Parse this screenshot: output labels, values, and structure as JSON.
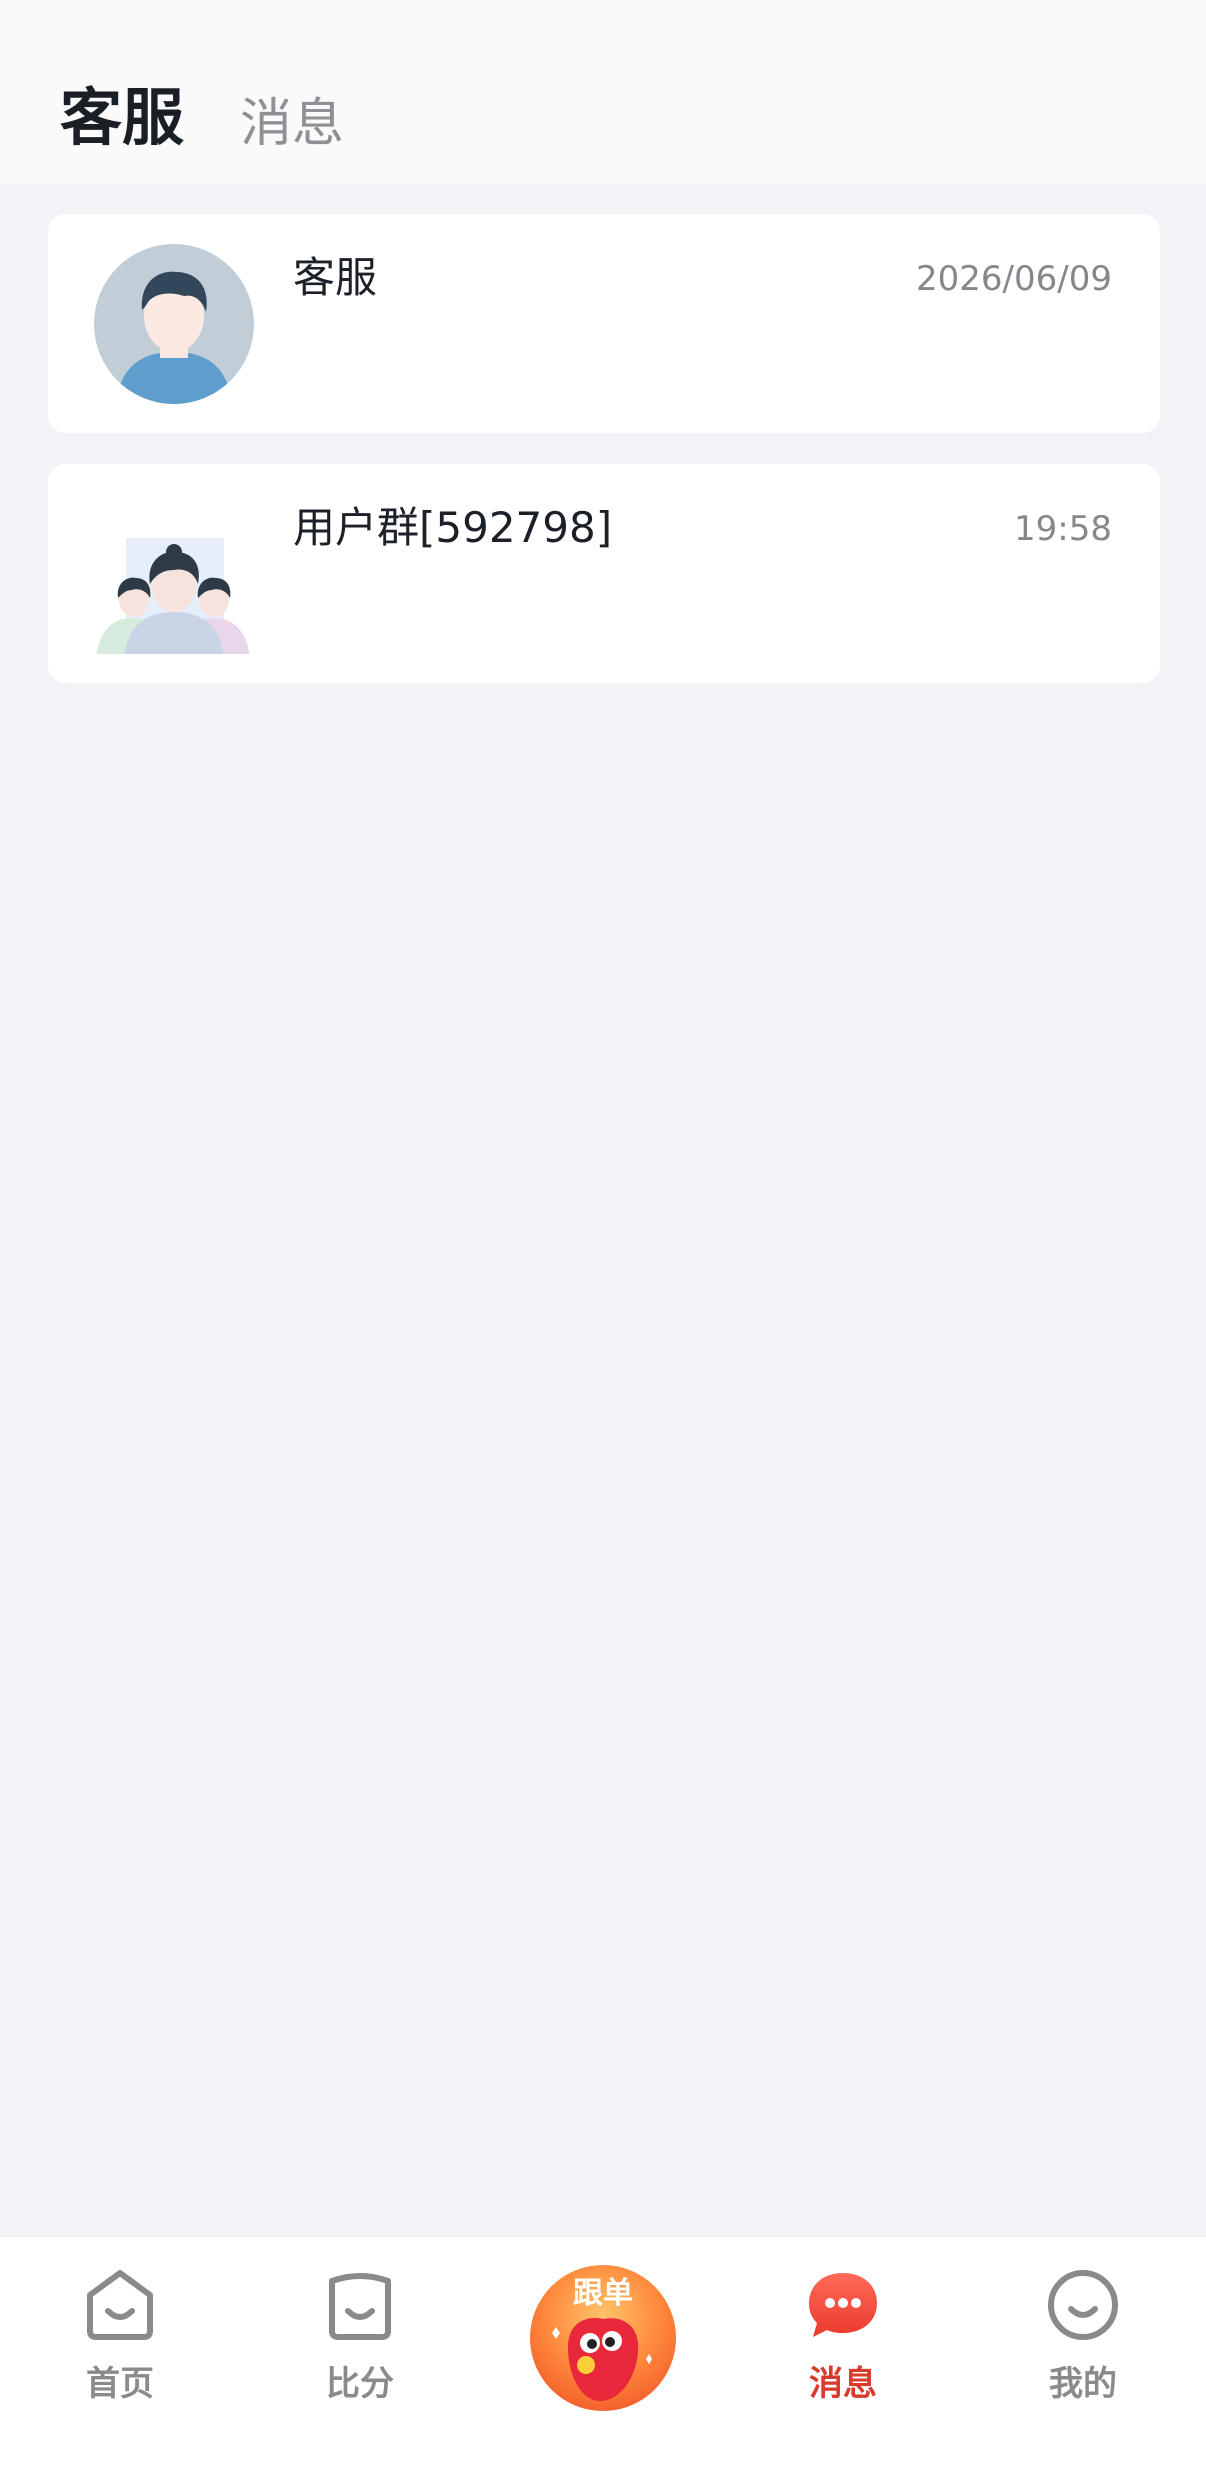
{
  "header": {
    "tabs": [
      {
        "label": "客服",
        "active": true
      },
      {
        "label": "消息",
        "active": false
      }
    ]
  },
  "conversations": [
    {
      "title": "客服",
      "time": "2026/06/09",
      "avatar": "person-avatar-icon"
    },
    {
      "title": "用户群[592798]",
      "time": "19:58",
      "avatar": "group-avatar-icon"
    }
  ],
  "tabbar": {
    "items": [
      {
        "label": "首页",
        "icon": "home-icon",
        "active": false
      },
      {
        "label": "比分",
        "icon": "scores-icon",
        "active": false
      },
      {
        "label": "跟单",
        "icon": "follow-order-icon",
        "active": false
      },
      {
        "label": "消息",
        "icon": "chat-bubble-icon",
        "active": true
      },
      {
        "label": "我的",
        "icon": "smile-face-icon",
        "active": false
      }
    ]
  },
  "colors": {
    "active": "#d93a2b",
    "inactive": "#8a8a8e",
    "background": "#f2f3f7"
  }
}
